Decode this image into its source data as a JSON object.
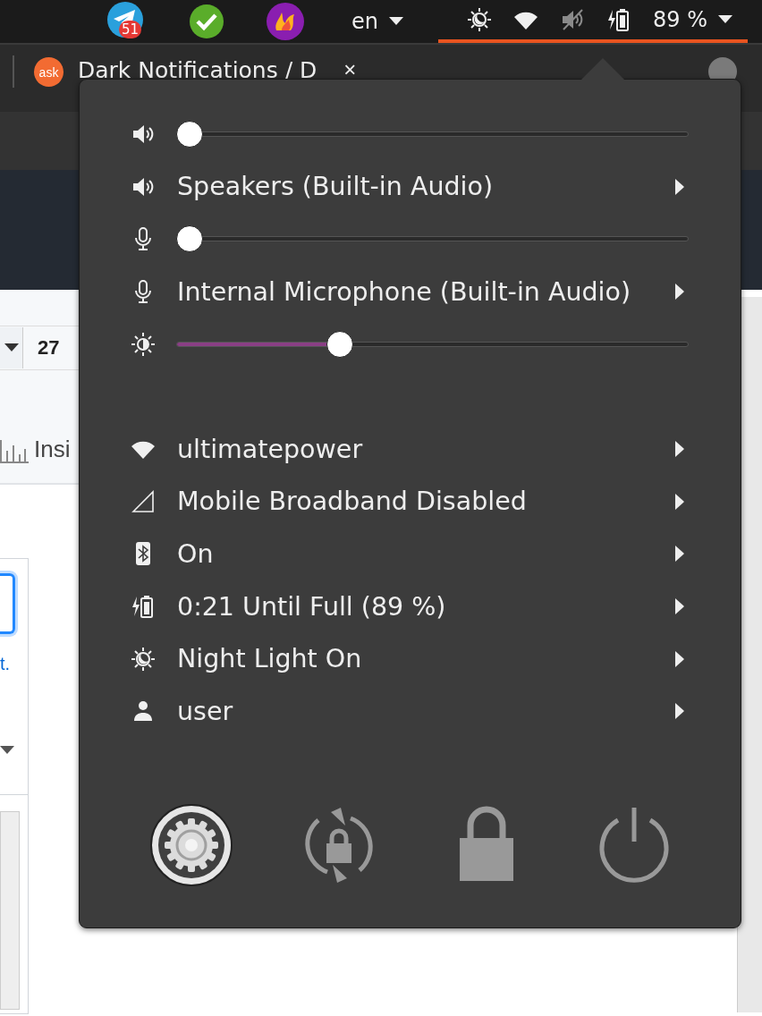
{
  "top_bar": {
    "tray_apps": [
      {
        "kind": "telegram",
        "badge": "51"
      },
      {
        "kind": "check"
      },
      {
        "kind": "flame"
      }
    ],
    "language": "en",
    "status_icons": [
      {
        "kind": "night"
      },
      {
        "kind": "wifi"
      },
      {
        "kind": "muted"
      },
      {
        "kind": "battery"
      }
    ],
    "battery": "89 %"
  },
  "browser": {
    "tab": {
      "logo": "ask",
      "title": "Dark Notifications / D",
      "close": "×"
    },
    "page": {
      "count": "27",
      "tab_label": "Insi",
      "link": "t."
    }
  },
  "menu": {
    "sections": [
      {
        "rows": [
          {
            "kind": "volume",
            "level": 0
          },
          {
            "kind": "output",
            "label": "Speakers (Built-in Audio)"
          },
          {
            "kind": "micvolume",
            "level": 0
          },
          {
            "kind": "input",
            "label": "Internal Microphone (Built-in Audio)"
          },
          {
            "kind": "brightness",
            "level": 0.31
          }
        ]
      },
      {
        "rows": [
          {
            "kind": "wifi",
            "label": "ultimatepower"
          },
          {
            "kind": "broadband",
            "label": "Mobile Broadband Disabled"
          },
          {
            "kind": "bluetooth",
            "label": "On"
          },
          {
            "kind": "power",
            "label": "0:21 Until Full (89 %)"
          },
          {
            "kind": "nightlight",
            "label": "Night Light On"
          },
          {
            "kind": "user",
            "label": "user"
          }
        ]
      }
    ],
    "actions": [
      {
        "kind": "settings"
      },
      {
        "kind": "lock-rotation"
      },
      {
        "kind": "lock"
      },
      {
        "kind": "power"
      }
    ]
  }
}
